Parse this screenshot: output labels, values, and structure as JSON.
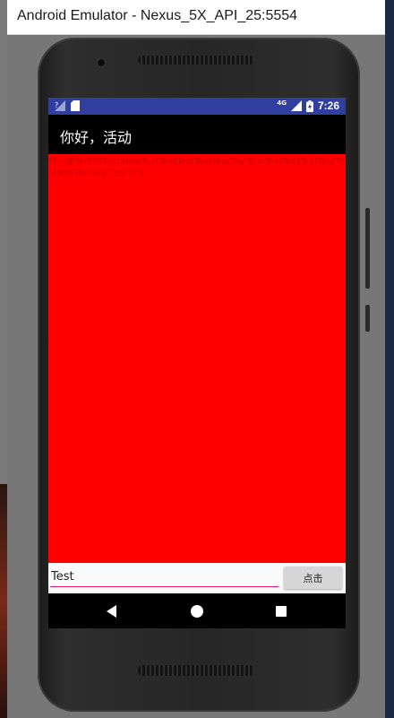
{
  "window": {
    "title": "Android Emulator - Nexus_5X_API_25:5554"
  },
  "status_bar": {
    "time": "7:26",
    "network_label": "4G",
    "icons": [
      "signal-icon",
      "sd-card-icon",
      "network-4g-icon",
      "battery-icon"
    ],
    "background_color": "#303f9f"
  },
  "app_bar": {
    "title": "你好，活动"
  },
  "content": {
    "text_view": "代码里修改的TextViewTestTestTestTestTestTestTestTestTestTestTestTestTestTestTestTestTest",
    "background_color": "#ff0000"
  },
  "input": {
    "value": "Test",
    "underline_color": "#e91e63"
  },
  "button": {
    "label": "点击"
  },
  "nav_bar": {
    "icons": [
      "back-icon",
      "home-icon",
      "recent-apps-icon"
    ]
  }
}
